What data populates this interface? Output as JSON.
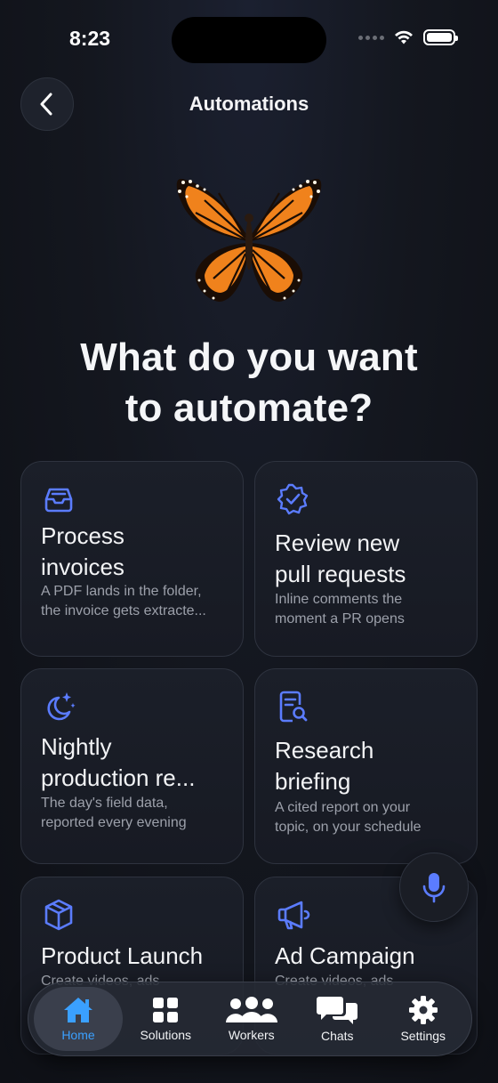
{
  "status_bar": {
    "time": "8:23"
  },
  "nav": {
    "title": "Automations"
  },
  "headline": {
    "line1": "What do you want",
    "line2": "to automate?"
  },
  "cards": [
    {
      "icon": "inbox-tray-icon",
      "title_line1": "Process",
      "title_line2": "invoices",
      "desc_line1": "A PDF lands in the folder,",
      "desc_line2": "the invoice gets extracte..."
    },
    {
      "icon": "verified-badge-icon",
      "title_line1": "Review new",
      "title_line2": "pull requests",
      "desc_line1": "Inline comments the",
      "desc_line2": "moment a PR opens"
    },
    {
      "icon": "moon-stars-icon",
      "title_line1": "Nightly",
      "title_line2": "production re...",
      "desc_line1": "The day's field data,",
      "desc_line2": "reported every evening"
    },
    {
      "icon": "document-search-icon",
      "title_line1": "Research",
      "title_line2": "briefing",
      "desc_line1": "A cited report on your",
      "desc_line2": "topic, on your schedule"
    },
    {
      "icon": "package-box-icon",
      "title_line1": "Product Launch",
      "title_line2": "",
      "desc_line1": "Create videos, ads",
      "desc_line2": ""
    },
    {
      "icon": "megaphone-icon",
      "title_line1": "Ad Campaign",
      "title_line2": "",
      "desc_line1": "Create videos, ads",
      "desc_line2": ""
    }
  ],
  "tabs": [
    {
      "label": "Home",
      "icon": "home-icon",
      "active": true
    },
    {
      "label": "Solutions",
      "icon": "grid-icon",
      "active": false
    },
    {
      "label": "Workers",
      "icon": "people-icon",
      "active": false
    },
    {
      "label": "Chats",
      "icon": "chat-bubbles-icon",
      "active": false
    },
    {
      "label": "Settings",
      "icon": "gear-icon",
      "active": false
    }
  ],
  "colors": {
    "accent": "#3aa0ff",
    "icon_blue": "#5b7cff",
    "card_bg": "#1a1e28",
    "background": "#12151c"
  }
}
